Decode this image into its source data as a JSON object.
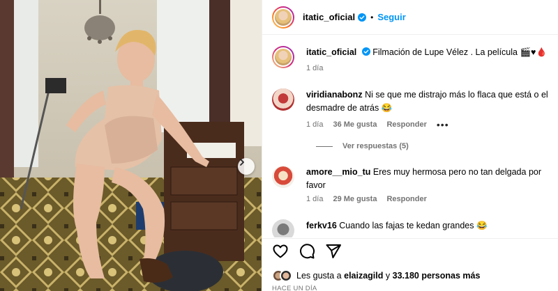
{
  "header": {
    "username": "itatic_oficial",
    "separator": "•",
    "follow_label": "Seguir"
  },
  "caption": {
    "username": "itatic_oficial",
    "text": "Filmación de Lupe Vélez . La película 🎬♥🩸",
    "time": "1 día"
  },
  "comments": [
    {
      "username": "viridianabonz",
      "text": "Ni se que me distrajo más lo flaca que está o el desmadre de atrás 😂",
      "time": "1 día",
      "likes": "36 Me gusta",
      "reply_label": "Responder",
      "more": "•••",
      "view_replies": "Ver respuestas (5)"
    },
    {
      "username": "amore__mio_tu",
      "text": "Eres muy hermosa pero no tan delgada por favor",
      "time": "1 día",
      "likes": "29 Me gusta",
      "reply_label": "Responder"
    },
    {
      "username": "ferkv16",
      "text": "Cuando las fajas te kedan grandes 😂"
    }
  ],
  "likes": {
    "prefix": "Les gusta a",
    "user": "elaizagild",
    "conj": "y",
    "count": "33.180 personas más"
  },
  "timestamp": "HACE UN DÍA",
  "icons": [
    "verified-icon",
    "heart-icon",
    "comment-icon",
    "share-icon",
    "chevron-right-icon",
    "more-icon"
  ],
  "colors": {
    "accent": "#0095f6",
    "secondary_text": "#737373",
    "border": "#efefef"
  }
}
